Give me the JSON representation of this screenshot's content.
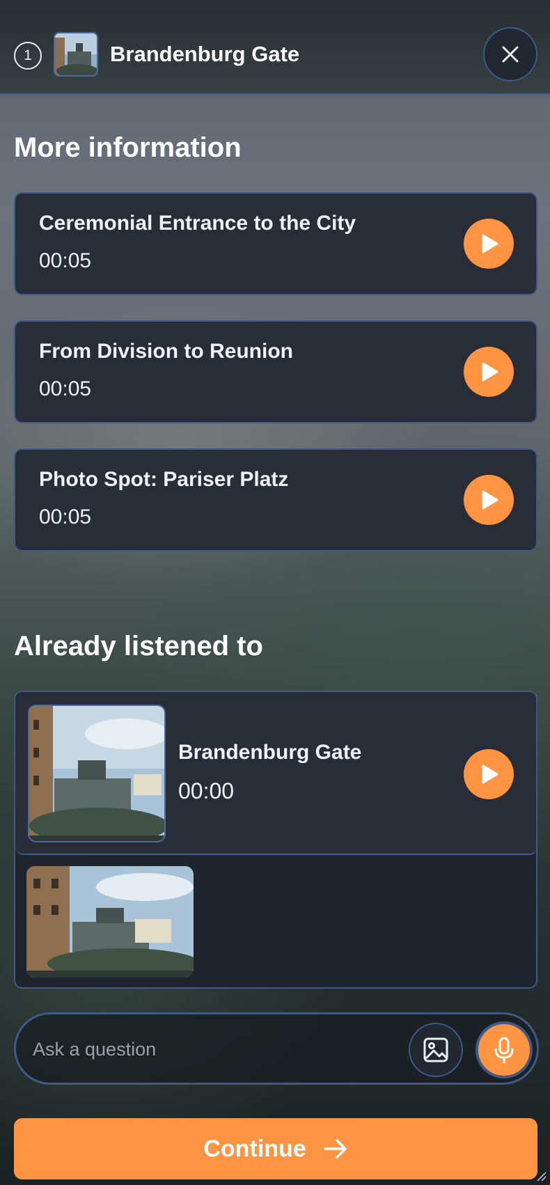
{
  "header": {
    "step_number": "1",
    "title": "Brandenburg Gate",
    "thumbnail_icon": "landmark-photo",
    "close_icon": "close-icon"
  },
  "more_info": {
    "title": "More information",
    "items": [
      {
        "title": "Ceremonial Entrance to the City",
        "duration": "00:05"
      },
      {
        "title": "From Division to Reunion",
        "duration": "00:05"
      },
      {
        "title": "Photo Spot: Pariser Platz",
        "duration": "00:05"
      }
    ]
  },
  "listened": {
    "title": "Already listened to",
    "items": [
      {
        "title": "Brandenburg Gate",
        "duration": "00:00"
      }
    ]
  },
  "ask": {
    "placeholder": "Ask a question",
    "image_icon": "image-icon",
    "mic_icon": "microphone-icon"
  },
  "continue": {
    "label": "Continue",
    "icon": "arrow-right-icon"
  },
  "colors": {
    "accent": "#ff9443",
    "border": "#3f5a86",
    "card": "#292d37"
  }
}
